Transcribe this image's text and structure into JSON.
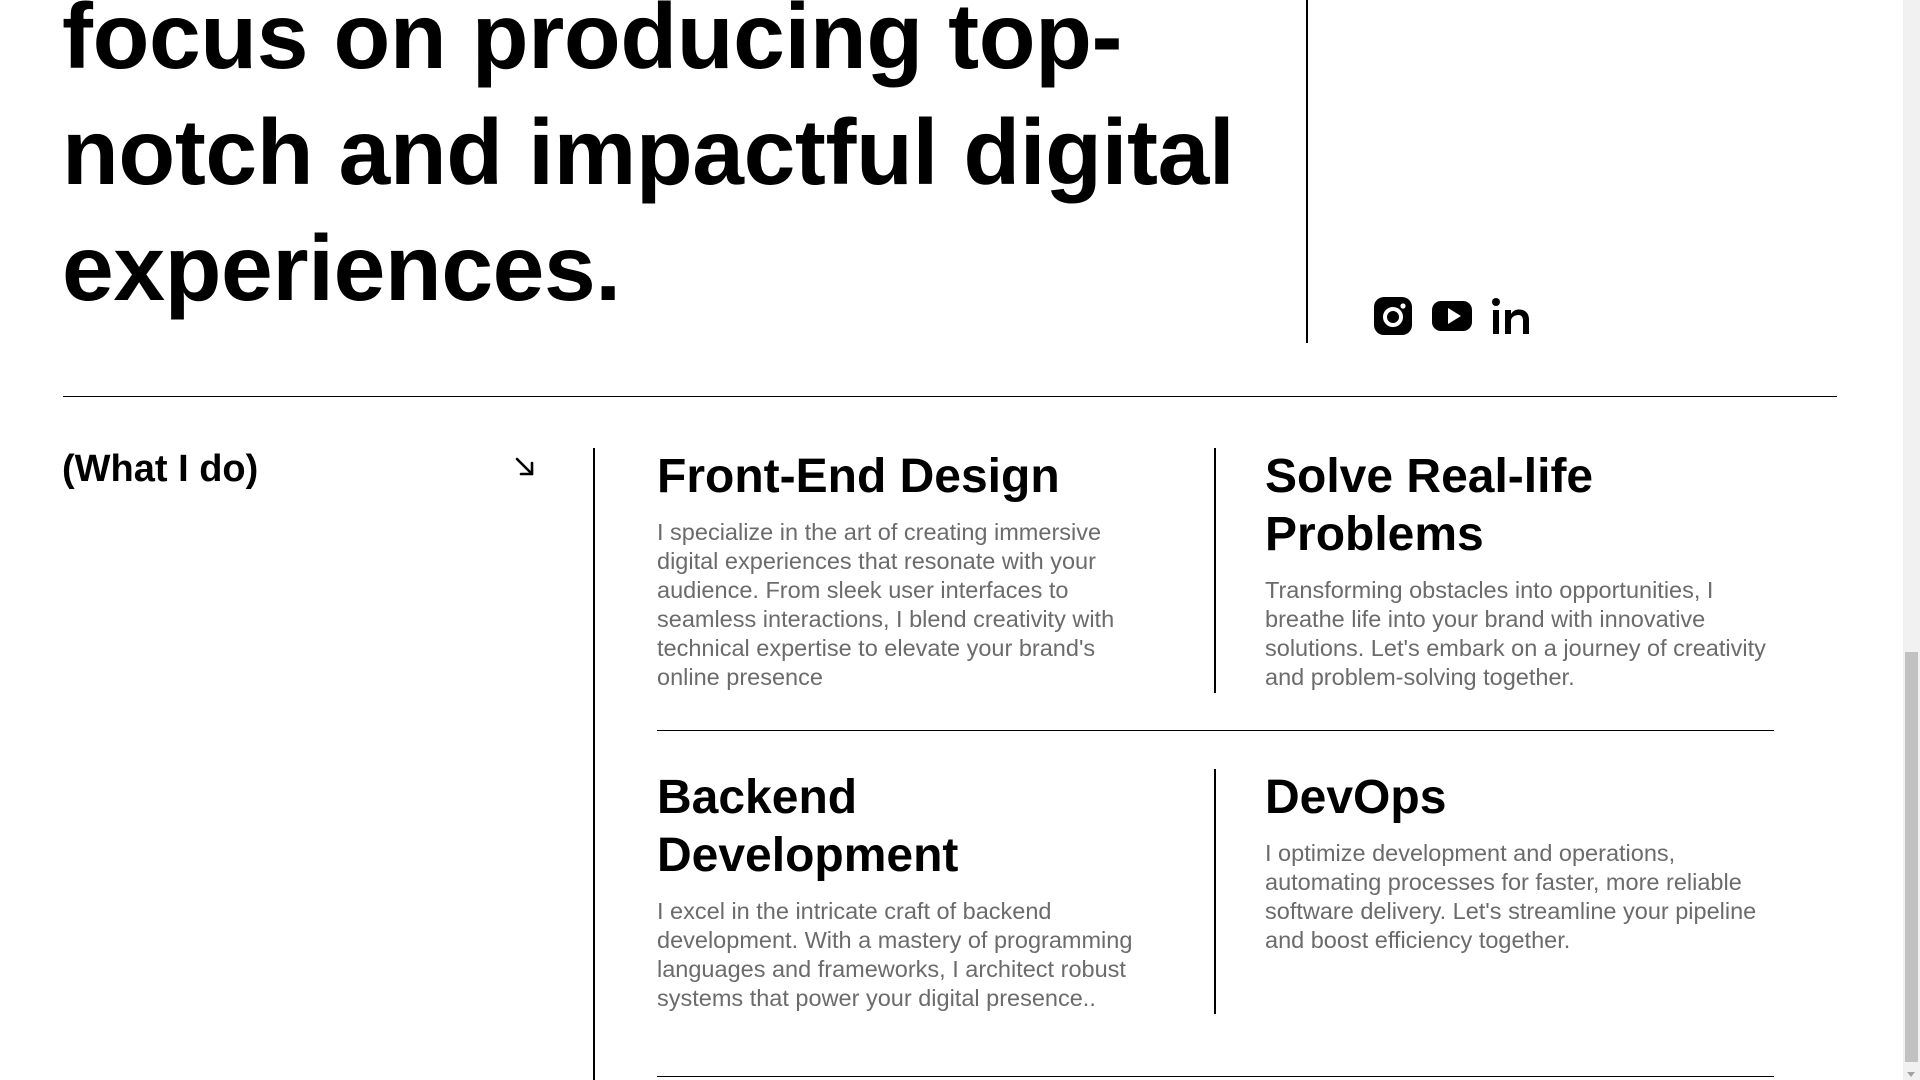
{
  "hero": {
    "text": "focus on producing top-notch and impactful digital experiences."
  },
  "social": {
    "items": [
      {
        "name": "instagram",
        "icon": "instagram-icon"
      },
      {
        "name": "youtube",
        "icon": "youtube-icon"
      },
      {
        "name": "linkedin",
        "icon": "linkedin-icon"
      }
    ]
  },
  "what_i_do": {
    "label": "(What I do)",
    "arrow_icon": "arrow-down-right-icon"
  },
  "services": [
    {
      "title": "Front-End Design",
      "description": "I specialize in the art of creating immersive digital experiences that resonate with your audience. From sleek user interfaces to seamless interactions, I blend creativity with technical expertise to elevate your brand's online presence"
    },
    {
      "title": "Solve Real-life Problems",
      "description": "Transforming obstacles into opportunities, I breathe life into your brand with innovative solutions. Let's embark on a journey of creativity and problem-solving together."
    },
    {
      "title": "Backend Development",
      "description": "I excel in the intricate craft of backend development. With a mastery of programming languages and frameworks, I architect robust systems that power your digital presence.."
    },
    {
      "title": "DevOps",
      "description": "I optimize development and operations, automating processes for faster, more reliable software delivery. Let's streamline your pipeline and boost efficiency together."
    }
  ],
  "colors": {
    "text": "#000000",
    "muted_text": "#6b6b6b",
    "background": "#ffffff"
  }
}
